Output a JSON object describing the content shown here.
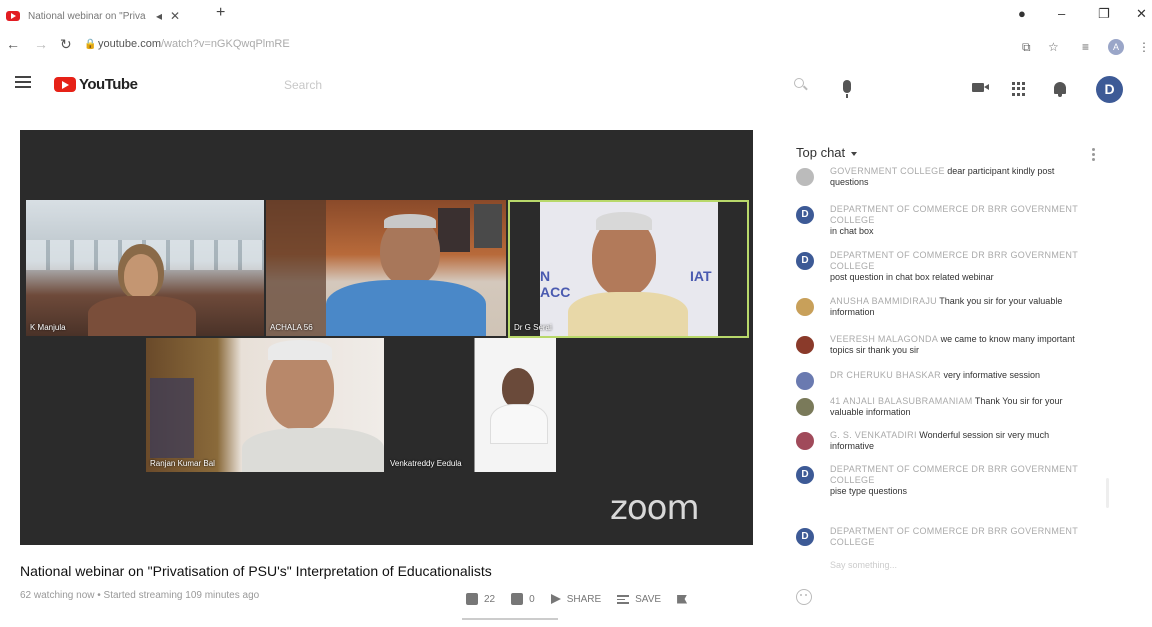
{
  "browser": {
    "tab_title": "National webinar on \"Priva",
    "url_domain": "youtube.com",
    "url_path": "/watch?v=nGKQwqPlmRE"
  },
  "youtube": {
    "logo_text": "YouTube",
    "search_placeholder": "Search",
    "avatar_letter": "D"
  },
  "video": {
    "participants": [
      {
        "name": "K Manjula"
      },
      {
        "name": "ACHALA 56"
      },
      {
        "name": "Dr G Serai"
      },
      {
        "name": "Ranjan Kumar Bal"
      },
      {
        "name": "Venkatreddy Eedula"
      }
    ],
    "watermark": "zoom",
    "title": "National webinar on \"Privatisation of PSU's\" Interpretation of Educationalists",
    "meta": "62 watching now • Started streaming 109 minutes ago",
    "likes": "22",
    "dislikes": "0",
    "share_label": "SHARE",
    "save_label": "SAVE"
  },
  "chat": {
    "header": "Top chat",
    "messages": [
      {
        "author": "GOVERNMENT COLLEGE",
        "text": "dear participant     kindly post questions",
        "avatar": "",
        "color": "#bbbbbb"
      },
      {
        "author": "DEPARTMENT OF COMMERCE Dr BRR GOVERNMENT COLLEGE",
        "text": "in chat box",
        "avatar": "D",
        "color": "#3d5a96"
      },
      {
        "author": "DEPARTMENT OF COMMERCE Dr BRR GOVERNMENT COLLEGE",
        "text": "post question in chat box   related webinar",
        "avatar": "D",
        "color": "#3d5a96"
      },
      {
        "author": "Anusha Bammidiraju",
        "text": "Thank you sir for your valuable information",
        "avatar": "",
        "color": "#c8a05a"
      },
      {
        "author": "Veeresh Malagonda",
        "text": "we came to know many important topics sir thank you sir",
        "avatar": "",
        "color": "#8a3a2a"
      },
      {
        "author": "DR CHERUKU BHASKAR",
        "text": "very informative session",
        "avatar": "",
        "color": "#6a7ab0"
      },
      {
        "author": "41 Anjali Balasubramaniam",
        "text": "Thank You sir for your valuable information",
        "avatar": "",
        "color": "#7a7a5a"
      },
      {
        "author": "G. S. VENKATADIRI",
        "text": "Wonderful session sir very much informative",
        "avatar": "",
        "color": "#a04a5a"
      },
      {
        "author": "DEPARTMENT OF COMMERCE Dr BRR GOVERNMENT COLLEGE",
        "text": "pise type questions",
        "avatar": "D",
        "color": "#3d5a96"
      },
      {
        "author": "DEPARTMENT OF COMMERCE Dr BRR GOVERNMENT COLLEGE",
        "text": "",
        "avatar": "D",
        "color": "#3d5a96"
      }
    ],
    "input_placeholder": "Say something..."
  }
}
